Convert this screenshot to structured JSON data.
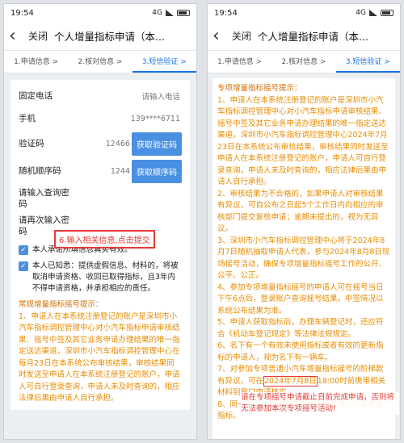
{
  "status": {
    "time": "19:54",
    "network": "4G",
    "battery": ""
  },
  "nav": {
    "close_label": "关闭",
    "title": "个人增量指标申请（本..."
  },
  "steps": [
    "1.申请信息 >",
    "2.核对信息 >",
    "3.短信验证 >"
  ],
  "form": {
    "fixed_phone_label": "固定电话",
    "fixed_phone_placeholder": "请输入电话",
    "mobile_label": "手机",
    "mobile_value": "139****6711",
    "code_label": "验证码",
    "code_value": "12466",
    "code_button": "获取验证码",
    "seq_label": "随机顺序码",
    "seq_value": "1244",
    "seq_button": "获取顺序码",
    "query_pwd_label": "请输入查询密码",
    "query_pwd_confirm_label": "请再次输入密码"
  },
  "annotation_left": "6.输入相关信息,点击提交",
  "commit1": "本人承诺所填信息真实有效。",
  "commit2": "本人已知悉：提供虚假信息、材料的，将被取消申请资格、收回已取得指标，且3年内不得申请资格，并承担相应的责任。",
  "notice_left": {
    "title": "常规增量指标摇号提示：",
    "p1": "1、申请人在本系统注册登记的账户是深圳市小汽车指标调控管理中心对小汽车指标申请审核结果、摇号中签及其它业务申请办理结果的唯一指定送达渠道，深圳市小汽车指标调控管理中心在每月23日在本系统公布审核结果，审核结果同时发送至申请人在本系统注册登记的账户，申请人可自行登录查询，申请人未及时查询的，相应法律后果由申请人自行承担。"
  },
  "notice_right": {
    "title": "专项增量指标摇号提示：",
    "p1": "1、申请人在本系统注册登记的账户是深圳市小汽车指标调控管理中心对小汽车指标申请审核结果、摇号中签及其它业务申请办理结果的唯一指定送达渠道，深圳市小汽车指标调控管理中心2024年7月23日在本系统公布审核结果，审核结果同时发送至申请人在本系统注册登记的账户，申请人可自行登录查询，申请人未及时查询的，相应法律后果由申请人自行承担。",
    "p2": "2、审核结果为不合格的，如果申请人对审核结果有异议，可自公布之日起5个工作日内向相应的审核部门提交复核申请；逾期未提出的，视为无异议。",
    "p3": "3、深圳市小汽车指标调控管理中心将于2024年8月7日随机抽取申请人代表，参与2024年8月8日现场摇号活动，确保专项增量指标摇号工作的公开、公平、公正。",
    "p4": "4、参加专项增量指标摇号的申请人可在摇号当日下午6点后，登录账户查询摇号结果。中签情况以系统公布结果为准。",
    "p5": "5、申请人获取指标后，办理车辆登记时，还应符合《机动车登记规定》等法律法规规定。",
    "p6": "6、名下有一个有效未使用指标或者有效的更新指标的申请人，视为名下有一辆车。",
    "p7a": "7、对参加专项普通小汽车增量指标摇号的阶梯款有异议，可在",
    "p7date": "2024年7月8日",
    "p7b": "18:00时前携带相关材料到窗口申请核实。",
    "p8": "8、同一申请人仅可申签一个专项普通小汽车增量指标。"
  },
  "annotation_right": "请在专项摇号申请截止日前完成申请，否则将无法参加本次专项摇号活动!"
}
